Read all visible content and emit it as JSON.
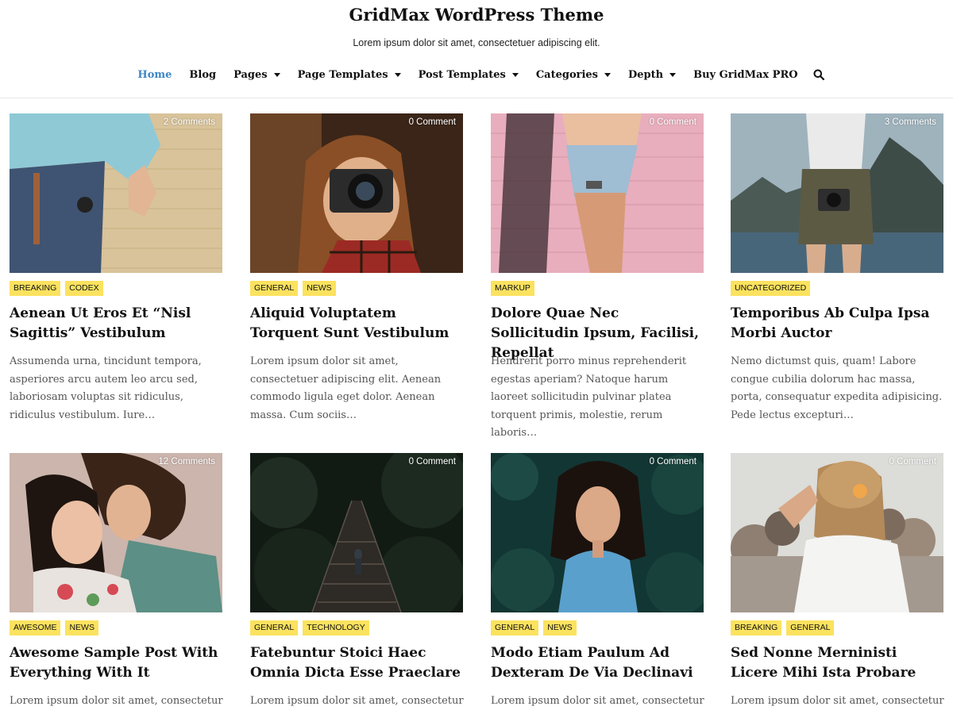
{
  "site": {
    "title": "GridMax WordPress Theme",
    "tagline": "Lorem ipsum dolor sit amet, consectetuer adipiscing elit."
  },
  "nav": {
    "items": [
      {
        "label": "Home",
        "active": true,
        "dropdown": false
      },
      {
        "label": "Blog",
        "active": false,
        "dropdown": false
      },
      {
        "label": "Pages",
        "active": false,
        "dropdown": true
      },
      {
        "label": "Page Templates",
        "active": false,
        "dropdown": true
      },
      {
        "label": "Post Templates",
        "active": false,
        "dropdown": true
      },
      {
        "label": "Categories",
        "active": false,
        "dropdown": true
      },
      {
        "label": "Depth",
        "active": false,
        "dropdown": true
      },
      {
        "label": "Buy GridMax PRO",
        "active": false,
        "dropdown": false
      }
    ],
    "search_icon": "search-icon",
    "active_color": "#3d86c6"
  },
  "colors": {
    "tag_background": "#fbe25f",
    "excerpt_text": "#555555"
  },
  "posts": [
    {
      "comments": "2 Comments",
      "tags": [
        "BREAKING",
        "CODEX"
      ],
      "title": "Aenean Ut Eros Et “Nisl Sagittis” Vestibulum",
      "excerpt": "Assumenda urna, tincidunt tempora, asperiores arcu autem leo arcu sed, laboriosam voluptas sit ridiculus, ridiculus vestibulum. Iure…"
    },
    {
      "comments": "0 Comment",
      "tags": [
        "GENERAL",
        "NEWS"
      ],
      "title": "Aliquid Voluptatem Torquent Sunt Vestibulum",
      "excerpt": "Lorem ipsum dolor sit amet, consectetuer adipiscing elit. Aenean commodo ligula eget dolor. Aenean massa. Cum sociis…"
    },
    {
      "comments": "0 Comment",
      "tags": [
        "MARKUP"
      ],
      "title": "Dolore Quae Nec Sollicitudin Ipsum, Facilisi, Repellat",
      "excerpt": "Hendrerit porro minus reprehenderit egestas aperiam? Natoque harum laoreet sollicitudin pulvinar platea torquent primis, molestie, rerum laboris…"
    },
    {
      "comments": "3 Comments",
      "tags": [
        "UNCATEGORIZED"
      ],
      "title": "Temporibus Ab Culpa Ipsa Morbi Auctor",
      "excerpt": "Nemo dictumst quis, quam! Labore congue cubilia dolorum hac massa, porta, consequatur expedita adipisicing. Pede lectus excepturi…"
    },
    {
      "comments": "12 Comments",
      "tags": [
        "AWESOME",
        "NEWS"
      ],
      "title": "Awesome Sample Post With Everything With It",
      "excerpt": "Lorem ipsum dolor sit amet, consectetur"
    },
    {
      "comments": "0 Comment",
      "tags": [
        "GENERAL",
        "TECHNOLOGY"
      ],
      "title": "Fatebuntur Stoici Haec Omnia Dicta Esse Praeclare",
      "excerpt": "Lorem ipsum dolor sit amet, consectetur"
    },
    {
      "comments": "0 Comment",
      "tags": [
        "GENERAL",
        "NEWS"
      ],
      "title": "Modo Etiam Paulum Ad Dexteram De Via Declinavi",
      "excerpt": "Lorem ipsum dolor sit amet, consectetur"
    },
    {
      "comments": "0 Comment",
      "tags": [
        "BREAKING",
        "GENERAL"
      ],
      "title": "Sed Nonne Merninisti Licere Mihi Ista Probare",
      "excerpt": "Lorem ipsum dolor sit amet, consectetur"
    }
  ]
}
